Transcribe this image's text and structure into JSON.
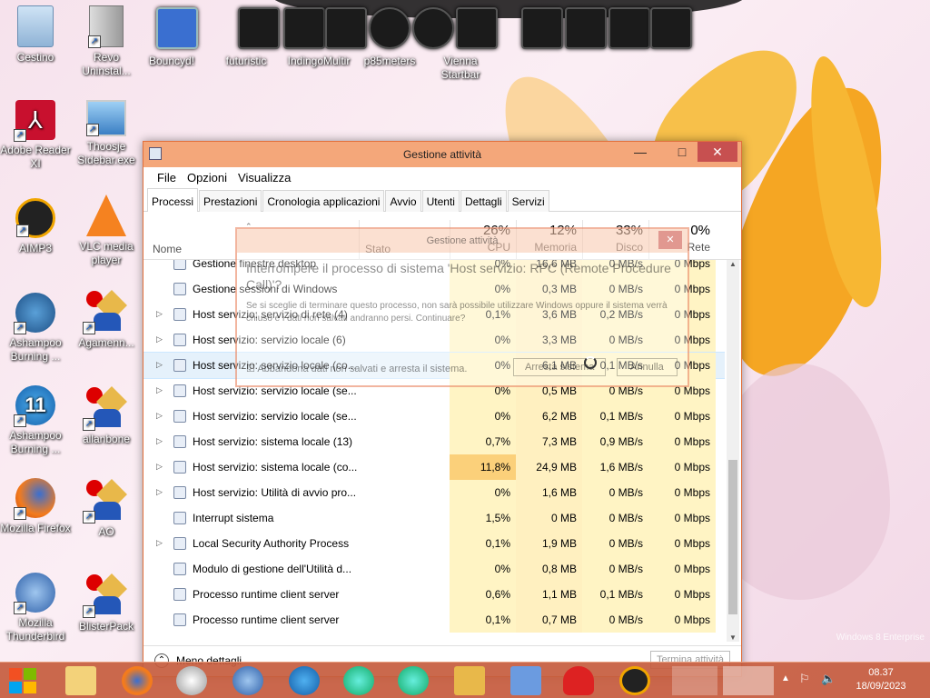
{
  "desktop": {
    "icons_left": [
      {
        "label": "Cestino",
        "icon": "recycle-bin-icon"
      },
      {
        "label": "Adobe Reader XI",
        "icon": "adobe-reader-icon"
      },
      {
        "label": "AIMP3",
        "icon": "aimp-icon"
      },
      {
        "label": "Ashampoo Burning ...",
        "icon": "ashampoo-icon"
      },
      {
        "label": "Ashampoo Burning ...",
        "icon": "ashampoo-11-icon"
      },
      {
        "label": "Mozilla Firefox",
        "icon": "firefox-icon"
      },
      {
        "label": "Mozilla Thunderbird",
        "icon": "thunderbird-icon"
      }
    ],
    "icons_col2": [
      {
        "label": "Revo Uninstal...",
        "icon": "revo-icon"
      },
      {
        "label": "Thoosje Sidebar.exe",
        "icon": "sidebar-icon"
      },
      {
        "label": "VLC media player",
        "icon": "vlc-icon"
      },
      {
        "label": "Agamenn...",
        "icon": "user-icon"
      },
      {
        "label": "allanbone",
        "icon": "user-icon"
      },
      {
        "label": "AO",
        "icon": "user-icon"
      },
      {
        "label": "BlisterPack",
        "icon": "user-icon"
      }
    ],
    "top_labels": [
      "Bouncyd!",
      "futuristic",
      "IndingoMultir",
      "p85meters",
      "Vienna Startbar"
    ],
    "watermark": "Windows 8 Enterprise"
  },
  "window": {
    "title": "Gestione attività",
    "minimize": "—",
    "maximize": "□",
    "close": "✕",
    "menu": [
      "File",
      "Opzioni",
      "Visualizza"
    ],
    "tabs": [
      "Processi",
      "Prestazioni",
      "Cronologia applicazioni",
      "Avvio",
      "Utenti",
      "Dettagli",
      "Servizi"
    ],
    "active_tab": "Processi",
    "columns": {
      "name": "Nome",
      "status": "Stato",
      "cpu": {
        "pct": "26%",
        "label": "CPU"
      },
      "mem": {
        "pct": "12%",
        "label": "Memoria"
      },
      "disk": {
        "pct": "33%",
        "label": "Disco"
      },
      "net": {
        "pct": "0%",
        "label": "Rete"
      }
    },
    "rows": [
      {
        "name": "Gestione finestre desktop",
        "cpu": "0%",
        "mem": "16,6 MB",
        "disk": "0 MB/s",
        "net": "0 Mbps",
        "expandable": false
      },
      {
        "name": "Gestione sessioni di Windows",
        "cpu": "0%",
        "mem": "0,3 MB",
        "disk": "0 MB/s",
        "net": "0 Mbps",
        "expandable": false
      },
      {
        "name": "Host servizio: servizio di rete (4)",
        "cpu": "0,1%",
        "mem": "3,6 MB",
        "disk": "0,2 MB/s",
        "net": "0 Mbps",
        "expandable": true
      },
      {
        "name": "Host servizio: servizio locale (6)",
        "cpu": "0%",
        "mem": "3,3 MB",
        "disk": "0 MB/s",
        "net": "0 Mbps",
        "expandable": true
      },
      {
        "name": "Host servizio: servizio locale (co...",
        "cpu": "0%",
        "mem": "6,1 MB",
        "disk": "0,1 MB/s",
        "net": "0 Mbps",
        "expandable": true
      },
      {
        "name": "Host servizio: servizio locale (se...",
        "cpu": "0%",
        "mem": "0,5 MB",
        "disk": "0 MB/s",
        "net": "0 Mbps",
        "expandable": true
      },
      {
        "name": "Host servizio: servizio locale (se...",
        "cpu": "0%",
        "mem": "6,2 MB",
        "disk": "0,1 MB/s",
        "net": "0 Mbps",
        "expandable": true
      },
      {
        "name": "Host servizio: sistema locale (13)",
        "cpu": "0,7%",
        "mem": "7,3 MB",
        "disk": "0,9 MB/s",
        "net": "0 Mbps",
        "expandable": true
      },
      {
        "name": "Host servizio: sistema locale (co...",
        "cpu": "11,8%",
        "mem": "24,9 MB",
        "disk": "1,6 MB/s",
        "net": "0 Mbps",
        "expandable": true
      },
      {
        "name": "Host servizio: Utilità di avvio pro...",
        "cpu": "0%",
        "mem": "1,6 MB",
        "disk": "0 MB/s",
        "net": "0 Mbps",
        "expandable": true
      },
      {
        "name": "Interrupt sistema",
        "cpu": "1,5%",
        "mem": "0 MB",
        "disk": "0 MB/s",
        "net": "0 Mbps",
        "expandable": false
      },
      {
        "name": "Local Security Authority Process",
        "cpu": "0,1%",
        "mem": "1,9 MB",
        "disk": "0 MB/s",
        "net": "0 Mbps",
        "expandable": true
      },
      {
        "name": "Modulo di gestione dell'Utilità d...",
        "cpu": "0%",
        "mem": "0,8 MB",
        "disk": "0 MB/s",
        "net": "0 Mbps",
        "expandable": false
      },
      {
        "name": "Processo runtime client server",
        "cpu": "0,6%",
        "mem": "1,1 MB",
        "disk": "0,1 MB/s",
        "net": "0 Mbps",
        "expandable": false
      },
      {
        "name": "Processo runtime client server",
        "cpu": "0,1%",
        "mem": "0,7 MB",
        "disk": "0 MB/s",
        "net": "0 Mbps",
        "expandable": false
      }
    ],
    "less_details": "Meno dettagli",
    "end_task": "Termina attività"
  },
  "dialog": {
    "title": "Gestione attività",
    "close": "✕",
    "heading": "Interrompere il processo di sistema 'Host servizio: RPC (Remote Procedure Call)'?",
    "body": "Se si sceglie di terminare questo processo, non sarà possibile utilizzare Windows oppure il sistema verrà chiuso e i dati non salvati andranno persi. Continuare?",
    "checkbox": "Abbandona dati non salvati e arresta il sistema.",
    "ok": "Arresta sistema",
    "cancel": "Annulla"
  },
  "taskbar": {
    "time": "08.37",
    "date": "18/09/2023"
  }
}
